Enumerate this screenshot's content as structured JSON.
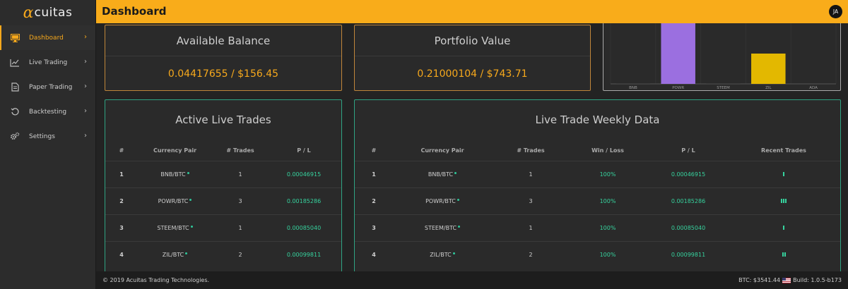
{
  "app": {
    "logo_alpha": "α",
    "logo_rest": "cuitas"
  },
  "sidebar": {
    "items": [
      {
        "label": "Dashboard",
        "icon": "monitor-icon",
        "active": true
      },
      {
        "label": "Live Trading",
        "icon": "line-chart-icon",
        "active": false
      },
      {
        "label": "Paper Trading",
        "icon": "document-icon",
        "active": false
      },
      {
        "label": "Backtesting",
        "icon": "history-icon",
        "active": false
      },
      {
        "label": "Settings",
        "icon": "gears-icon",
        "active": false
      }
    ]
  },
  "header": {
    "title": "Dashboard",
    "avatar_initials": "JA"
  },
  "cards": {
    "balance": {
      "title": "Available Balance",
      "value": "0.04417655 / $156.45"
    },
    "portfolio": {
      "title": "Portfolio Value",
      "value": "0.21000104 / $743.71"
    }
  },
  "chart_data": {
    "type": "bar",
    "categories": [
      "BNB",
      "POWR",
      "STEEM",
      "ZIL",
      "ADA"
    ],
    "values": [
      0.5,
      100,
      0.5,
      50,
      0
    ],
    "colors": [
      "#4a4a4a",
      "#9b6fe0",
      "#4a4a4a",
      "#e3b800",
      "#4a4a4a"
    ],
    "ylim": [
      0,
      100
    ],
    "grid": true
  },
  "active_trades": {
    "title": "Active Live Trades",
    "columns": [
      "#",
      "Currency Pair",
      "# Trades",
      "P / L"
    ],
    "rows": [
      {
        "num": "1",
        "pair": "BNB/BTC",
        "trades": "1",
        "pl": "0.00046915"
      },
      {
        "num": "2",
        "pair": "POWR/BTC",
        "trades": "3",
        "pl": "0.00185286"
      },
      {
        "num": "3",
        "pair": "STEEM/BTC",
        "trades": "1",
        "pl": "0.00085040"
      },
      {
        "num": "4",
        "pair": "ZIL/BTC",
        "trades": "2",
        "pl": "0.00099811"
      }
    ]
  },
  "weekly": {
    "title": "Live Trade Weekly Data",
    "columns": [
      "#",
      "Currency Pair",
      "# Trades",
      "Win / Loss",
      "P / L",
      "Recent Trades"
    ],
    "rows": [
      {
        "num": "1",
        "pair": "BNB/BTC",
        "trades": "1",
        "winloss": "100%",
        "pl": "0.00046915",
        "recent": 1
      },
      {
        "num": "2",
        "pair": "POWR/BTC",
        "trades": "3",
        "winloss": "100%",
        "pl": "0.00185286",
        "recent": 3
      },
      {
        "num": "3",
        "pair": "STEEM/BTC",
        "trades": "1",
        "winloss": "100%",
        "pl": "0.00085040",
        "recent": 1
      },
      {
        "num": "4",
        "pair": "ZIL/BTC",
        "trades": "2",
        "winloss": "100%",
        "pl": "0.00099811",
        "recent": 2
      }
    ]
  },
  "footer": {
    "copyright": "© 2019 Acuitas Trading Technologies.",
    "btc": "BTC: $3541.44",
    "build": "Build: 1.0.5-b173",
    "flag_icon": "us-flag-icon"
  }
}
